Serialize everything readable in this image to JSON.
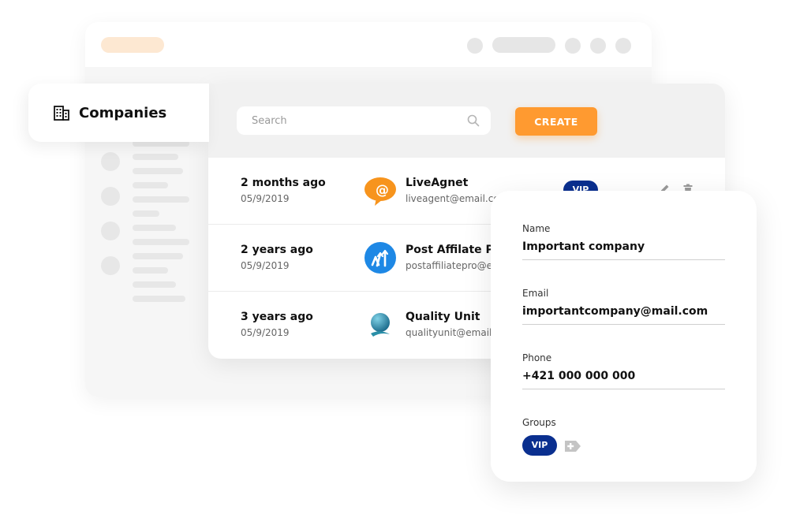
{
  "header": {
    "title": "Companies",
    "title_icon": "building-icon"
  },
  "toolbar": {
    "search_placeholder": "Search",
    "search_icon": "search-icon",
    "create_label": "CREATE"
  },
  "companies": [
    {
      "when": "2 months ago",
      "date": "05/9/2019",
      "name": "LiveAgnet",
      "email": "liveagent@email.com",
      "logo": "liveagent-logo",
      "tag": "VIP"
    },
    {
      "when": "2 years ago",
      "date": "05/9/2019",
      "name": "Post Affilate Pro",
      "email": "postaffiliatepro@email.com",
      "logo": "postaffiliatepro-logo"
    },
    {
      "when": "3 years ago",
      "date": "05/9/2019",
      "name": "Quality Unit",
      "email": "qualityunit@email.com",
      "logo": "qualityunit-logo"
    }
  ],
  "row_actions": [
    "edit-icon",
    "trash-icon"
  ],
  "detail": {
    "name_label": "Name",
    "name_value": "Important company",
    "email_label": "Email",
    "email_value": "importantcompany@mail.com",
    "phone_label": "Phone",
    "phone_value": "+421 000 000 000",
    "groups_label": "Groups",
    "groups": [
      "VIP"
    ],
    "add_group_icon": "add-tag-icon"
  },
  "colors": {
    "accent_orange": "#ff9a30",
    "vip_blue": "#0a2f8f",
    "liveagent_orange": "#f7941d",
    "pap_blue": "#1e88e5",
    "qu_teal": "#2a8fa8"
  }
}
